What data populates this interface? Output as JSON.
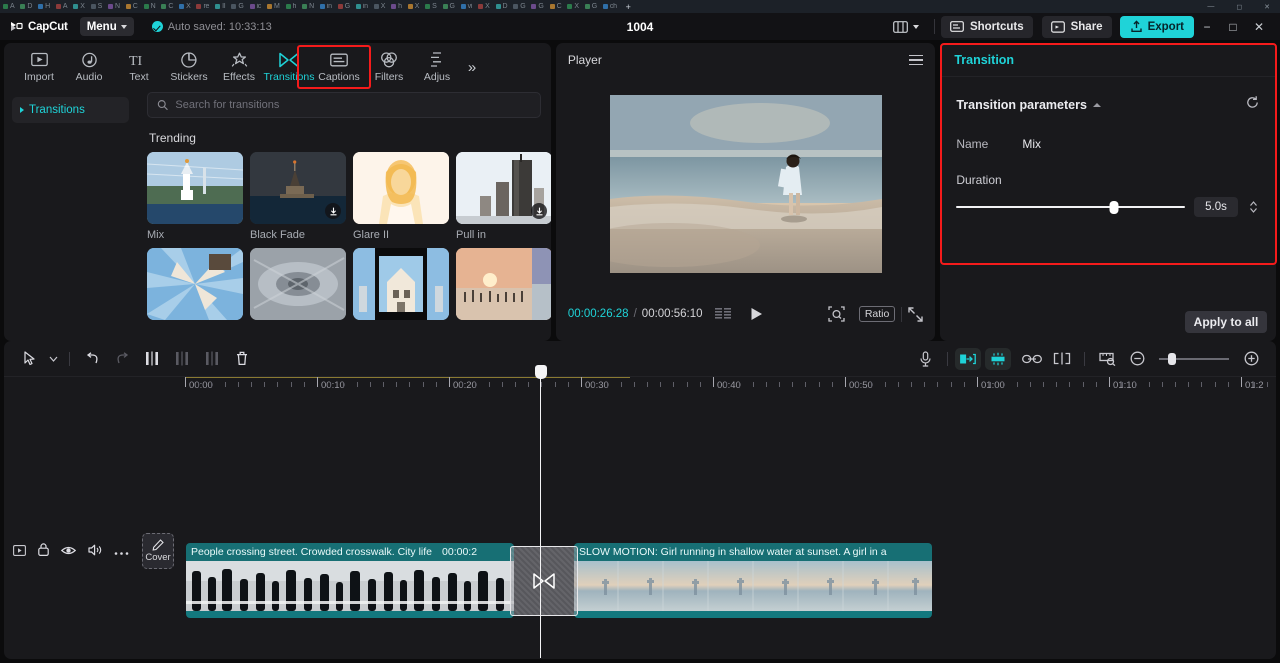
{
  "browser": {
    "tabs": [
      {
        "label": "A"
      },
      {
        "label": "D"
      },
      {
        "label": "H"
      },
      {
        "label": "A"
      },
      {
        "label": "X"
      },
      {
        "label": "S"
      },
      {
        "label": "N"
      },
      {
        "label": "C"
      },
      {
        "label": "N"
      },
      {
        "label": "C"
      },
      {
        "label": "X"
      },
      {
        "label": "re"
      },
      {
        "label": "II"
      },
      {
        "label": "G"
      },
      {
        "label": "ic"
      },
      {
        "label": "M"
      },
      {
        "label": "h"
      },
      {
        "label": "N"
      },
      {
        "label": "in"
      },
      {
        "label": "G"
      },
      {
        "label": "in"
      },
      {
        "label": "X"
      },
      {
        "label": "h"
      },
      {
        "label": "X"
      },
      {
        "label": "S"
      },
      {
        "label": "G"
      },
      {
        "label": "vi"
      },
      {
        "label": "X"
      },
      {
        "label": "D"
      },
      {
        "label": "G"
      },
      {
        "label": "G"
      },
      {
        "label": "C"
      },
      {
        "label": "X"
      },
      {
        "label": "G"
      },
      {
        "label": "ch"
      }
    ],
    "new_tab_label": "+"
  },
  "titlebar": {
    "brand": "CapCut",
    "menu_label": "Menu",
    "autosave_text": "Auto saved: 10:33:13",
    "project_title": "1004",
    "layout_icon": "layout-icon",
    "shortcuts_label": "Shortcuts",
    "share_label": "Share",
    "export_label": "Export",
    "minimize": "−",
    "maximize": "□",
    "close": "✕",
    "accent_color": "#1fd3d8"
  },
  "toolbar": {
    "tabs": [
      {
        "label": "Import",
        "icon": "import-icon",
        "active": false
      },
      {
        "label": "Audio",
        "icon": "audio-note-icon",
        "active": false
      },
      {
        "label": "Text",
        "icon": "text-icon",
        "active": false
      },
      {
        "label": "Stickers",
        "icon": "sticker-icon",
        "active": false
      },
      {
        "label": "Effects",
        "icon": "effects-sparkle-icon",
        "active": false
      },
      {
        "label": "Transitions",
        "icon": "transitions-bowtie-icon",
        "active": true
      },
      {
        "label": "Captions",
        "icon": "captions-icon",
        "active": false
      },
      {
        "label": "Filters",
        "icon": "filters-circles-icon",
        "active": false
      },
      {
        "label": "Adjus",
        "icon": "adjust-sliders-icon",
        "active": false
      }
    ],
    "more_label": "»",
    "highlight_color": "#f51b1b"
  },
  "library": {
    "category_label": "Transitions",
    "search_placeholder": "Search for transitions",
    "search_value": "",
    "section_title": "Trending",
    "items": [
      {
        "label": "Mix",
        "thumb": "g1",
        "download": false
      },
      {
        "label": "Black Fade",
        "thumb": "g2",
        "download": true
      },
      {
        "label": "Glare II",
        "thumb": "g3",
        "download": false
      },
      {
        "label": "Pull in",
        "thumb": "g4",
        "download": true
      },
      {
        "label": "",
        "thumb": "g5",
        "download": false
      },
      {
        "label": "",
        "thumb": "g6",
        "download": false
      },
      {
        "label": "",
        "thumb": "g7",
        "download": false
      },
      {
        "label": "",
        "thumb": "g8",
        "download": false
      }
    ]
  },
  "player": {
    "title": "Player",
    "menu_icon": "hamburger-icon",
    "current_time": "00:00:26:28",
    "time_separator": "/",
    "total_time": "00:00:56:10",
    "frames_icon": "frames-icon",
    "play_icon": "play-icon",
    "zoom_fit_icon": "zoom-fit-icon",
    "ratio_label": "Ratio",
    "fullscreen_icon": "fullscreen-icon"
  },
  "attributes": {
    "panel_title": "Transition",
    "section_title": "Transition parameters",
    "collapse_icon": "chevron-up-icon",
    "reset_icon": "reset-icon",
    "name_label": "Name",
    "name_value": "Mix",
    "duration_label": "Duration",
    "duration_value": "5.0s",
    "duration_percent": 69,
    "apply_to_all_label": "Apply to all",
    "title_color": "#1fd3d8",
    "highlight_color": "#f51b1b"
  },
  "timeline": {
    "tools_left": [
      {
        "icon": "select-arrow-icon",
        "name": "select-tool",
        "dim": false
      },
      {
        "icon": "chevron-down-icon",
        "name": "select-tool-dropdown",
        "dim": false
      },
      {
        "icon": "undo-icon",
        "name": "undo-button",
        "dim": false
      },
      {
        "icon": "redo-icon",
        "name": "redo-button",
        "dim": true
      },
      {
        "icon": "split-icon",
        "name": "split-button",
        "dim": false
      },
      {
        "icon": "trim-left-icon",
        "name": "delete-left-button",
        "dim": true
      },
      {
        "icon": "trim-right-icon",
        "name": "delete-right-button",
        "dim": true
      },
      {
        "icon": "trash-icon",
        "name": "delete-button",
        "dim": false
      }
    ],
    "tools_right": [
      {
        "icon": "microphone-icon",
        "name": "record-voiceover-button",
        "active": false
      },
      {
        "icon": "mirror-icon",
        "name": "mirror-button",
        "active": true
      },
      {
        "icon": "freeze-icon",
        "name": "freeze-button",
        "active": true
      },
      {
        "icon": "link-icon",
        "name": "link-button",
        "active": false
      },
      {
        "icon": "cut-icon",
        "name": "cut-button",
        "active": false
      },
      {
        "icon": "preview-icon",
        "name": "preview-button",
        "active": false
      },
      {
        "icon": "zoom-out-icon",
        "name": "zoom-out-button",
        "active": false
      },
      {
        "icon": "zoom-in-icon",
        "name": "zoom-in-button",
        "active": false
      }
    ],
    "zoom_percent": 18,
    "ruler_labels": [
      "00:00",
      "00:10",
      "00:20",
      "00:30",
      "00:40",
      "00:50",
      "01:00",
      "01:10",
      "01:2"
    ],
    "playhead_label": "",
    "track_controls": [
      {
        "icon": "video-track-icon",
        "name": "track-type-icon"
      },
      {
        "icon": "lock-icon",
        "name": "lock-track-button"
      },
      {
        "icon": "eye-icon",
        "name": "hide-track-button"
      },
      {
        "icon": "speaker-icon",
        "name": "mute-track-button"
      },
      {
        "icon": "ellipsis-icon",
        "name": "more-track-options-button"
      }
    ],
    "cover_label": "Cover",
    "cover_icon": "pencil-icon",
    "clips": [
      {
        "title": "People crossing street. Crowded crosswalk. City life",
        "duration": "00:00:2"
      },
      {
        "title": "SLOW MOTION: Girl running in shallow water at sunset. A girl in a",
        "duration": ""
      }
    ],
    "transition_marker_icon": "transitions-bowtie-icon"
  }
}
